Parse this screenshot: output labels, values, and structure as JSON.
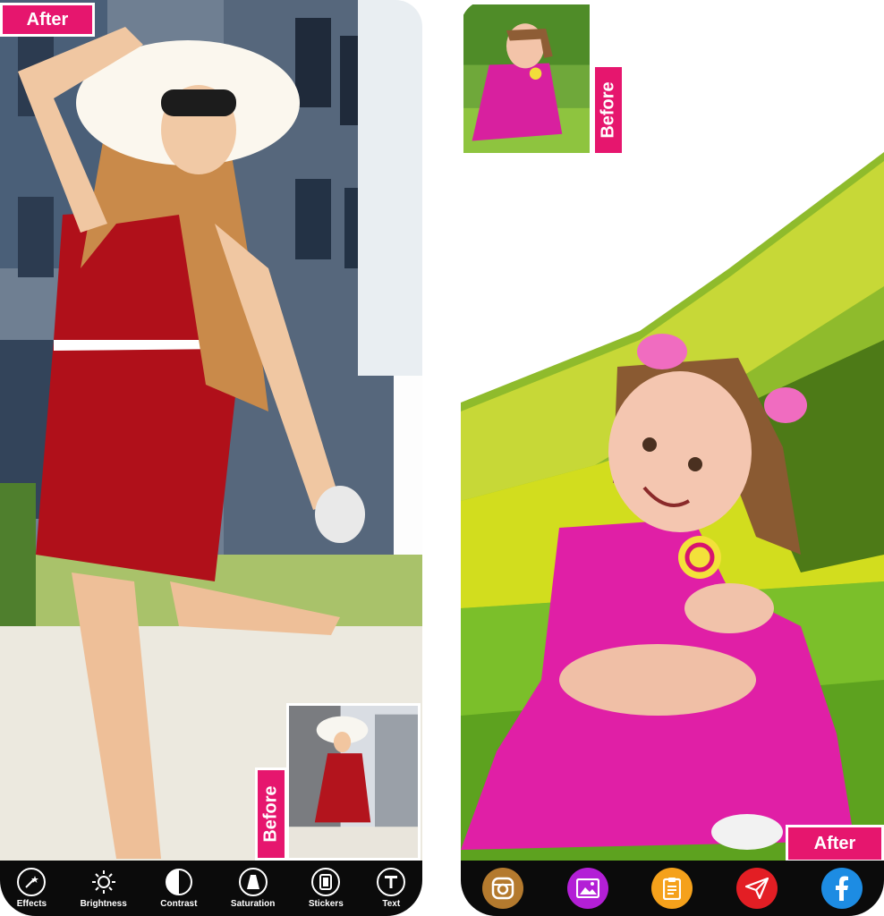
{
  "left_phone": {
    "after_label": "After",
    "before_label": "Before",
    "tools": [
      {
        "label": "Effects",
        "icon": "magic-wand-icon"
      },
      {
        "label": "Brightness",
        "icon": "sun-icon"
      },
      {
        "label": "Contrast",
        "icon": "contrast-icon"
      },
      {
        "label": "Saturation",
        "icon": "drop-icon"
      },
      {
        "label": "Stickers",
        "icon": "sticker-icon"
      },
      {
        "label": "Text",
        "icon": "text-icon"
      }
    ]
  },
  "right_phone": {
    "after_label": "After",
    "before_label": "Before",
    "share_buttons": [
      {
        "icon": "instagram-icon",
        "color": "#b47a2e"
      },
      {
        "icon": "gallery-icon",
        "color": "#b31fd6"
      },
      {
        "icon": "clipboard-icon",
        "color": "#f5a11b"
      },
      {
        "icon": "send-icon",
        "color": "#e31e24"
      },
      {
        "icon": "facebook-icon",
        "color": "#1d8ce3"
      }
    ]
  },
  "colors": {
    "accent": "#e6166e",
    "toolbar": "#0b0b0b"
  }
}
